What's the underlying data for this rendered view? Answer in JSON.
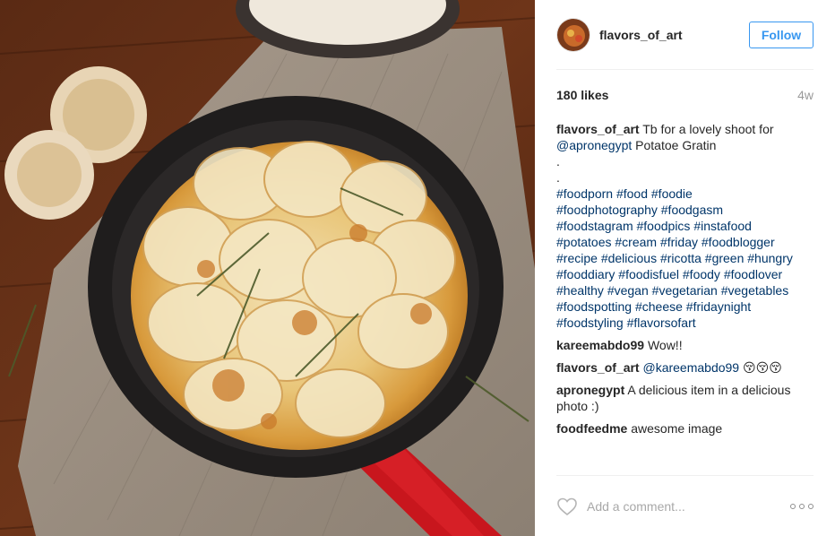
{
  "photo": {
    "alt": "Potatoe Gratin in a red cast iron skillet"
  },
  "author": {
    "username": "flavors_of_art",
    "follow_label": "Follow"
  },
  "post": {
    "likes": "180 likes",
    "time_ago": "4w"
  },
  "caption": {
    "username": "flavors_of_art",
    "text_before": "Tb for a lovely shoot for",
    "mention": "@apronegypt",
    "text_after": "Potatoe Gratin",
    "dots": [
      ".",
      "."
    ],
    "hashtag_lines": [
      [
        "#foodporn",
        "#food",
        "#foodie"
      ],
      [
        "#foodphotography",
        "#foodgasm"
      ],
      [
        "#foodstagram",
        "#foodpics",
        "#instafood"
      ],
      [
        "#potatoes",
        "#cream",
        "#friday",
        "#foodblogger"
      ],
      [
        "#recipe",
        "#delicious",
        "#ricotta",
        "#green",
        "#hungry"
      ],
      [
        "#fooddiary",
        "#foodisfuel",
        "#foody",
        "#foodlover"
      ],
      [
        "#healthy",
        "#vegan",
        "#vegetarian",
        "#vegetables"
      ],
      [
        "#foodspotting",
        "#cheese",
        "#fridaynight"
      ],
      [
        "#foodstyling",
        "#flavorsofart"
      ]
    ]
  },
  "comments": [
    {
      "user": "kareemabdo99",
      "text": "Wow!!"
    },
    {
      "user": "flavors_of_art",
      "mention": "@kareemabdo99",
      "text": "😚😚😚"
    },
    {
      "user": "apronegypt",
      "text": "A delicious item in a delicious photo :)"
    },
    {
      "user": "foodfeedme",
      "text": "awesome image"
    }
  ],
  "footer": {
    "comment_placeholder": "Add a comment...",
    "like_icon": "heart-outline-icon",
    "more_icon": "more-options-icon"
  },
  "colors": {
    "link": "#003569",
    "follow": "#3897f0",
    "muted": "#999999"
  }
}
